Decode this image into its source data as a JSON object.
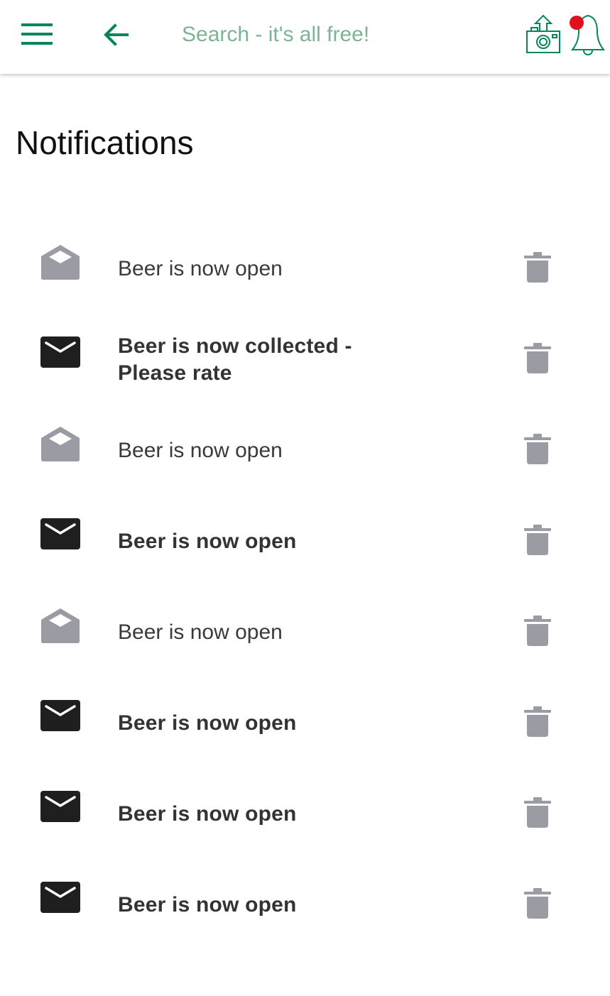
{
  "header": {
    "search_placeholder": "Search - it's all free!",
    "brand_color": "#00875a",
    "notification_dot_color": "#e0111c",
    "icons": {
      "menu": "hamburger-menu-icon",
      "back": "arrow-left-icon",
      "camera": "camera-upload-icon",
      "bell": "bell-icon"
    }
  },
  "page": {
    "title": "Notifications"
  },
  "notifications": [
    {
      "text": "Beer is now open",
      "read": true
    },
    {
      "text": "Beer is now collected - Please rate",
      "read": false
    },
    {
      "text": "Beer is now open",
      "read": true
    },
    {
      "text": "Beer is now open",
      "read": false
    },
    {
      "text": "Beer is now open",
      "read": true
    },
    {
      "text": "Beer is now open",
      "read": false
    },
    {
      "text": "Beer is now open",
      "read": false
    },
    {
      "text": "Beer is now open",
      "read": false
    }
  ],
  "colors": {
    "read_icon": "#9b9ca3",
    "unread_icon": "#1f1f1f",
    "trash_icon": "#9b9ca3"
  }
}
